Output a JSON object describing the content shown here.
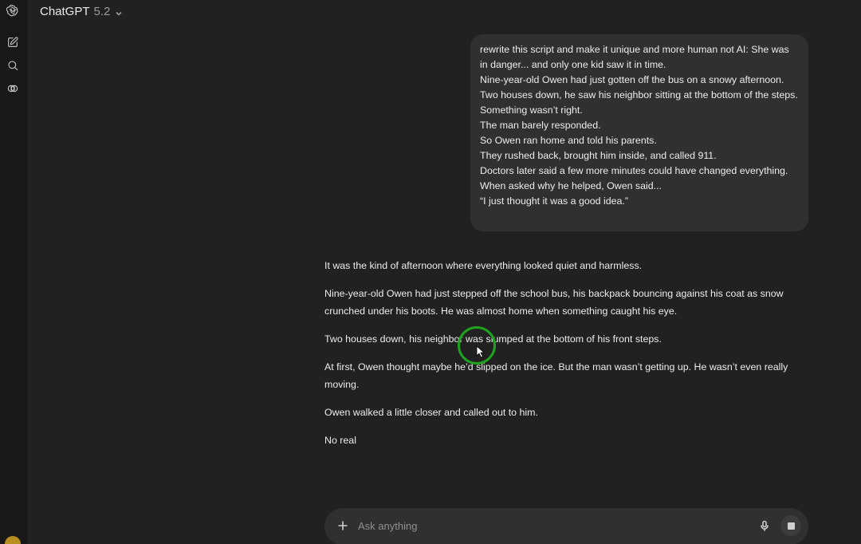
{
  "app": {
    "name": "ChatGPT",
    "version": "5.2"
  },
  "sidebar": {
    "icons": [
      "openai-logo-icon",
      "new-chat-icon",
      "search-icon",
      "library-icon"
    ]
  },
  "user_message": {
    "lines": [
      "rewrite this script and make it unique and more human not AI: She was in danger... and only one kid saw it in time.",
      "Nine-year-old Owen had just gotten off the bus on a snowy afternoon.",
      "Two houses down, he saw his neighbor sitting at the bottom of the steps.",
      "Something wasn’t right.",
      "The man barely responded.",
      "So Owen ran home and told his parents.",
      "They rushed back, brought him inside, and called 911.",
      "Doctors later said a few more minutes could have changed everything.",
      "When asked why he helped, Owen said...",
      "“I just thought it was a good idea.”"
    ]
  },
  "assistant_message": {
    "paragraphs": [
      "It was the kind of afternoon where everything looked quiet and harmless.",
      "Nine-year-old Owen had just stepped off the school bus, his backpack bouncing against his coat as snow crunched under his boots. He was almost home when something caught his eye.",
      "Two houses down, his neighbor was slumped at the bottom of his front steps.",
      "At first, Owen thought maybe he’d slipped on the ice. But the man wasn’t getting up. He wasn’t even really moving.",
      "Owen walked a little closer and called out to him.",
      "No real"
    ]
  },
  "composer": {
    "placeholder": "Ask anything",
    "value": ""
  },
  "colors": {
    "background": "#212121",
    "bubble": "#303030",
    "cursor_ring": "#1fa31f"
  }
}
